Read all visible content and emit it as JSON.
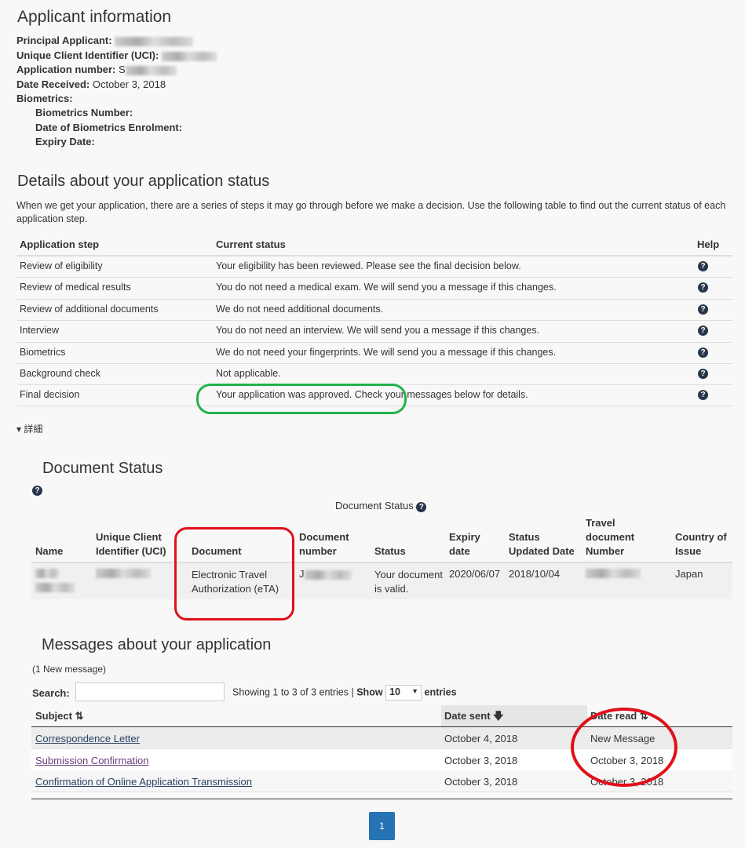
{
  "applicant": {
    "title": "Applicant information",
    "principal_label": "Principal Applicant:",
    "uci_label": "Unique Client Identifier (UCI):",
    "appnum_label": "Application number:",
    "appnum_prefix": "S",
    "date_label": "Date Received:",
    "date_value": "October 3, 2018",
    "bio_label": "Biometrics:",
    "bio_number_label": "Biometrics Number:",
    "bio_date_label": "Date of Biometrics Enrolment:",
    "expiry_label": "Expiry Date:"
  },
  "status": {
    "title": "Details about your application status",
    "intro": "When we get your application, there are a series of steps it may go through before we make a decision. Use the following table to find out the current status of each application step.",
    "headers": [
      "Application step",
      "Current status",
      "Help"
    ],
    "rows": [
      {
        "step": "Review of eligibility",
        "status": "Your eligibility has been reviewed. Please see the final decision below."
      },
      {
        "step": "Review of medical results",
        "status": "You do not need a medical exam. We will send you a message if this changes."
      },
      {
        "step": "Review of additional documents",
        "status": "We do not need additional documents."
      },
      {
        "step": "Interview",
        "status": "You do not need an interview. We will send you a message if this changes."
      },
      {
        "step": "Biometrics",
        "status": "We do not need your fingerprints. We will send you a message if this changes."
      },
      {
        "step": "Background check",
        "status": "Not applicable."
      },
      {
        "step": "Final decision",
        "status": "Your application was approved. Check your messages below for details."
      }
    ],
    "details_toggle": "▾ 詳細"
  },
  "document": {
    "title": "Document Status",
    "caption": "Document Status",
    "headers": [
      "Name",
      "Unique Client Identifier (UCI)",
      "Document",
      "Document number",
      "Status",
      "Expiry date",
      "Status Updated Date",
      "Travel document Number",
      "Country of Issue"
    ],
    "row": {
      "document": "Electronic Travel Authorization (eTA)",
      "docnum_prefix": "J",
      "status": "Your document is valid.",
      "expiry": "2020/06/07",
      "updated": "2018/10/04",
      "country": "Japan"
    }
  },
  "messages": {
    "title": "Messages about your application",
    "count": "(1 New message)",
    "search_label": "Search:",
    "search_value": "",
    "showing": "Showing 1 to 3 of 3 entries |",
    "show_label": "Show",
    "show_value": "10",
    "entries_label": "entries",
    "headers": {
      "subject": "Subject ⇅",
      "sent": "Date sent 🡇",
      "read": "Date read ⇅"
    },
    "rows": [
      {
        "subject": "Correspondence Letter",
        "sent": "October 4, 2018",
        "read": "New Message"
      },
      {
        "subject": "Submission Confirmation",
        "sent": "October 3, 2018",
        "read": "October 3, 2018"
      },
      {
        "subject": "Confirmation of Online Application Transmission",
        "sent": "October 3, 2018",
        "read": "October 3, 2018"
      }
    ],
    "page": "1"
  },
  "colors": {
    "accent": "#2572b4",
    "annotation_red": "#e0101a",
    "annotation_green": "#22b14c",
    "help_icon": "#26374a"
  }
}
